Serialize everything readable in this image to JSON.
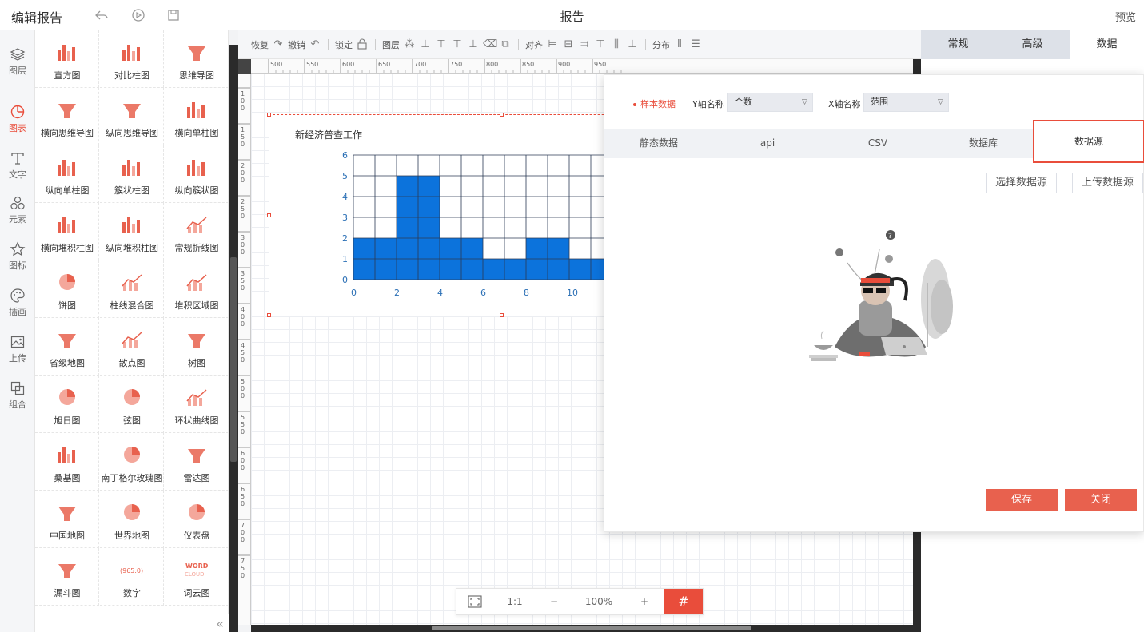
{
  "app": {
    "title": "编辑报告",
    "page_title": "报告",
    "preview": "预览",
    "icons": [
      "back-icon",
      "play-icon",
      "save-icon"
    ]
  },
  "rail": {
    "items": [
      {
        "label": "图层",
        "icon": "layers-icon"
      },
      {
        "label": "图表",
        "icon": "chart-pie-icon",
        "active": true
      },
      {
        "label": "文字",
        "icon": "text-icon"
      },
      {
        "label": "元素",
        "icon": "elements-icon"
      },
      {
        "label": "图标",
        "icon": "star-icon"
      },
      {
        "label": "插画",
        "icon": "palette-icon"
      },
      {
        "label": "上传",
        "icon": "image-upload-icon"
      },
      {
        "label": "组合",
        "icon": "group-icon"
      }
    ]
  },
  "palette": {
    "items": [
      {
        "label": "直方图",
        "icon": "histogram-icon"
      },
      {
        "label": "对比柱图",
        "icon": "compare-bar-icon"
      },
      {
        "label": "思维导图",
        "icon": "mindmap-icon"
      },
      {
        "label": "横向思维导图",
        "icon": "horizontal-mindmap-icon"
      },
      {
        "label": "纵向思维导图",
        "icon": "vertical-mindmap-icon"
      },
      {
        "label": "横向单柱图",
        "icon": "horizontal-bar-icon"
      },
      {
        "label": "纵向单柱图",
        "icon": "vertical-bar-icon"
      },
      {
        "label": "簇状柱图",
        "icon": "cluster-bar-icon"
      },
      {
        "label": "纵向簇状图",
        "icon": "vertical-cluster-icon"
      },
      {
        "label": "横向堆积柱图",
        "icon": "horizontal-stack-icon"
      },
      {
        "label": "纵向堆积柱图",
        "icon": "vertical-stack-icon"
      },
      {
        "label": "常规折线图",
        "icon": "line-chart-icon"
      },
      {
        "label": "饼图",
        "icon": "pie-icon"
      },
      {
        "label": "柱线混合图",
        "icon": "bar-line-icon"
      },
      {
        "label": "堆积区域图",
        "icon": "stacked-area-icon"
      },
      {
        "label": "省级地图",
        "icon": "province-map-icon"
      },
      {
        "label": "散点图",
        "icon": "scatter-icon"
      },
      {
        "label": "树图",
        "icon": "tree-icon"
      },
      {
        "label": "旭日图",
        "icon": "sunburst-icon"
      },
      {
        "label": "弦图",
        "icon": "chord-icon"
      },
      {
        "label": "环状曲线图",
        "icon": "radial-curve-icon"
      },
      {
        "label": "桑基图",
        "icon": "sankey-icon"
      },
      {
        "label": "南丁格尔玫瑰图",
        "icon": "rose-icon"
      },
      {
        "label": "雷达图",
        "icon": "radar-icon"
      },
      {
        "label": "中国地图",
        "icon": "china-map-icon"
      },
      {
        "label": "世界地图",
        "icon": "world-map-icon"
      },
      {
        "label": "仪表盘",
        "icon": "gauge-icon"
      },
      {
        "label": "漏斗图",
        "icon": "funnel-icon"
      },
      {
        "label": "数字",
        "icon": "number-icon",
        "sample": "965.0"
      },
      {
        "label": "词云图",
        "icon": "wordcloud-icon",
        "sample": "WORD CLOUD"
      }
    ]
  },
  "toolbar": {
    "redo": "恢复",
    "undo": "撤销",
    "lock": "锁定",
    "layer": "图层",
    "align": "对齐",
    "distribute": "分布"
  },
  "ruler": {
    "top_ticks": [
      "500",
      "550",
      "600",
      "650",
      "700",
      "750",
      "800",
      "850",
      "900",
      "950"
    ],
    "left_ticks": [
      "100",
      "150",
      "200",
      "250",
      "300",
      "350",
      "400",
      "450",
      "500",
      "550",
      "600",
      "650",
      "700",
      "750"
    ]
  },
  "chart_data": {
    "type": "bar",
    "title": "新经济普查工作",
    "x": [
      0,
      2,
      4,
      6,
      8,
      10
    ],
    "bins": [
      {
        "x0": 0,
        "x1": 2,
        "value": 2
      },
      {
        "x0": 2,
        "x1": 4,
        "value": 5
      },
      {
        "x0": 4,
        "x1": 6,
        "value": 2
      },
      {
        "x0": 6,
        "x1": 8,
        "value": 1
      },
      {
        "x0": 8,
        "x1": 10,
        "value": 2
      },
      {
        "x0": 10,
        "x1": 12,
        "value": 1
      }
    ],
    "ylim": [
      0,
      6
    ],
    "yticks": [
      0,
      1,
      2,
      3,
      4,
      5,
      6
    ],
    "xticks": [
      0,
      2,
      4,
      6,
      8,
      10
    ],
    "grid": true,
    "bar_color": "#0c73dc"
  },
  "zoom": {
    "fit_icon": "fit-screen-icon",
    "one_to_one": "1:1",
    "minus": "−",
    "level": "100%",
    "plus": "+",
    "grid_icon": "grid-icon"
  },
  "right_panel": {
    "tabs": [
      {
        "label": "常规",
        "active": false
      },
      {
        "label": "高级",
        "active": false
      },
      {
        "label": "数据",
        "active": true
      }
    ]
  },
  "modal": {
    "sample_label": "样本数据",
    "y_label": "Y轴名称",
    "y_value": "个数",
    "x_label": "X轴名称",
    "x_value": "范围",
    "tabs": [
      "静态数据",
      "api",
      "CSV",
      "数据库",
      "数据源"
    ],
    "active_tab": "数据源",
    "select_source": "选择数据源",
    "upload_source": "上传数据源",
    "save": "保存",
    "close": "关闭"
  },
  "colors": {
    "accent": "#e94d3b",
    "bar": "#0c73dc",
    "button": "#e8614e"
  }
}
